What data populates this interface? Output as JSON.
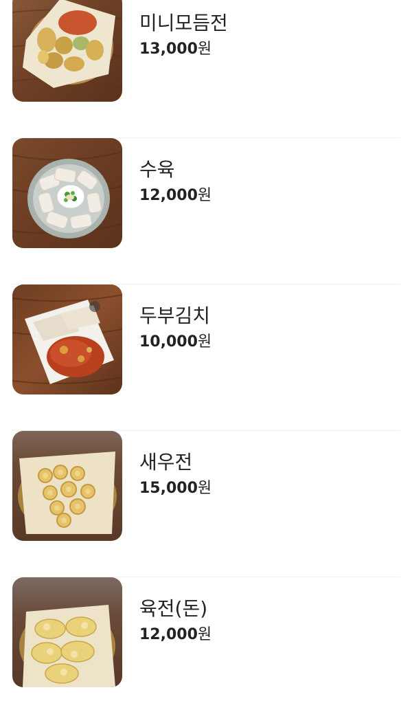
{
  "menu": {
    "items": [
      {
        "name": "미니모듬전",
        "price": "13,000",
        "unit": "원",
        "image": "assorted-jeon-photo"
      },
      {
        "name": "수육",
        "price": "12,000",
        "unit": "원",
        "image": "boiled-pork-photo"
      },
      {
        "name": "두부김치",
        "price": "10,000",
        "unit": "원",
        "image": "tofu-kimchi-photo"
      },
      {
        "name": "새우전",
        "price": "15,000",
        "unit": "원",
        "image": "shrimp-jeon-photo"
      },
      {
        "name": "육전(돈)",
        "price": "12,000",
        "unit": "원",
        "image": "pork-yukjeon-photo"
      }
    ]
  },
  "colors": {
    "text": "#222222",
    "divider": "#efefef",
    "wood": "#7a4a2c"
  }
}
